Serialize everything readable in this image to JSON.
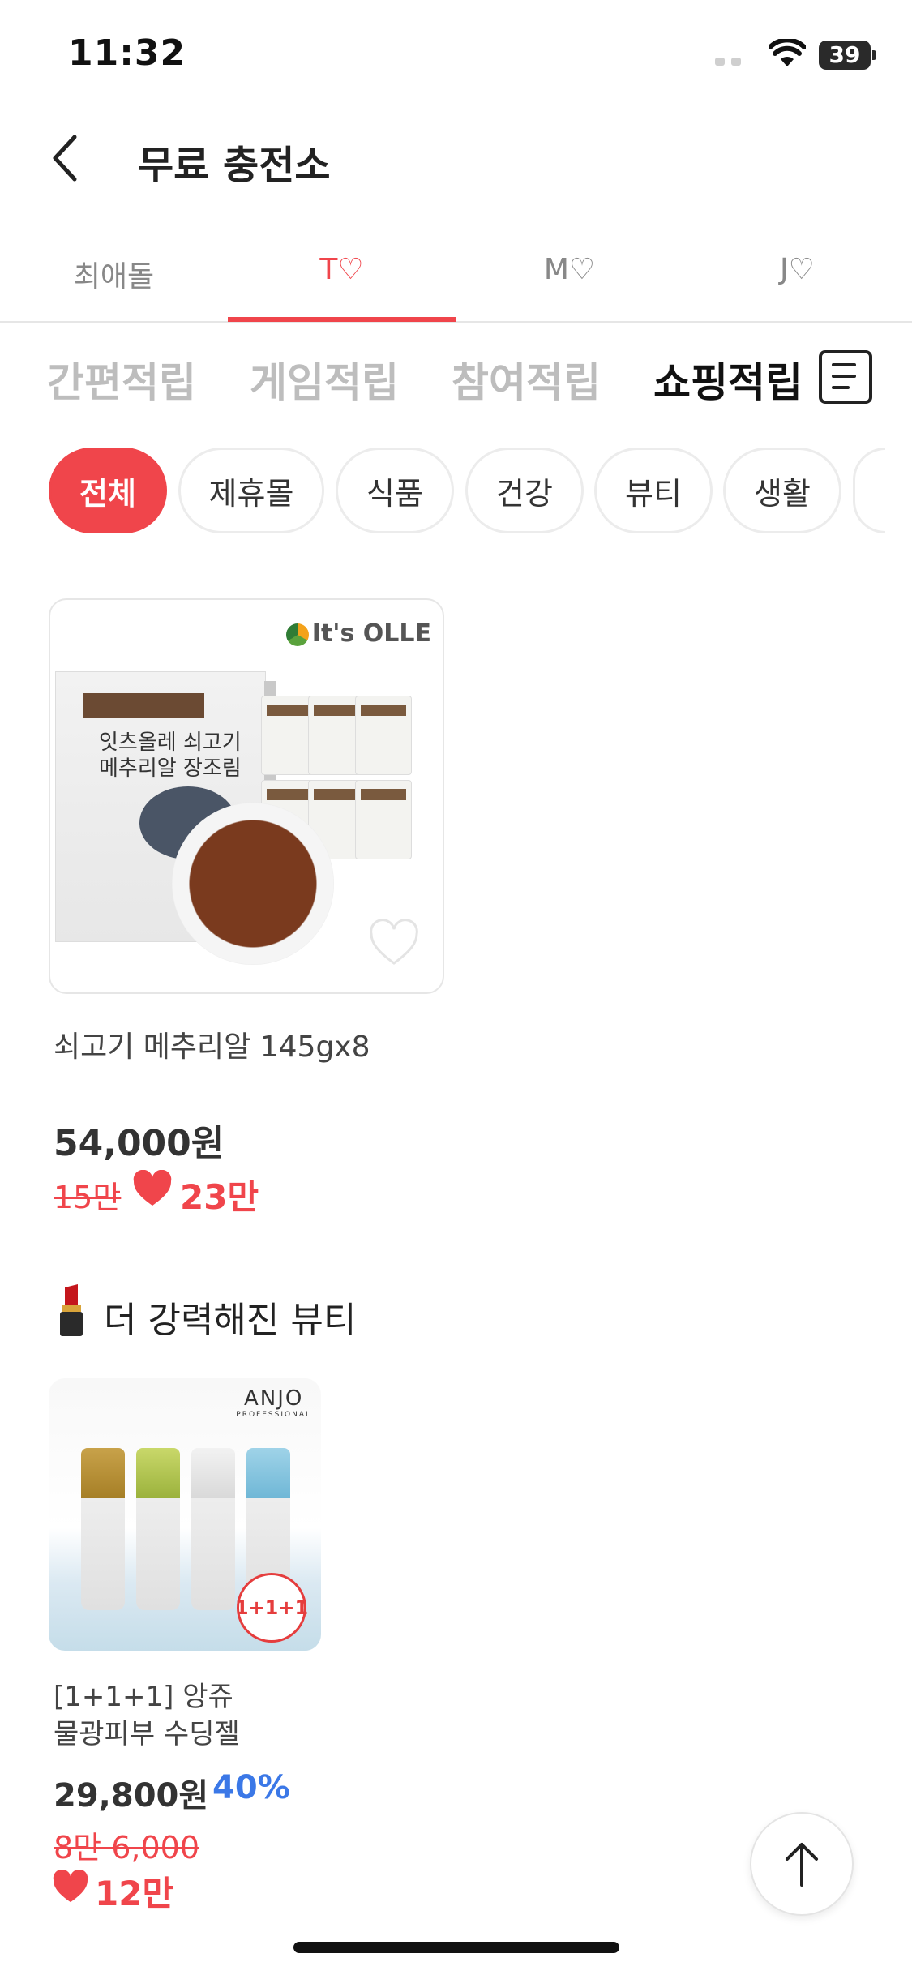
{
  "status": {
    "time": "11:32",
    "battery": "39"
  },
  "header": {
    "title": "무료 충전소",
    "back_icon": "chevron-left-icon"
  },
  "profile_tabs": [
    {
      "label": "최애돌"
    },
    {
      "label": "T♡",
      "active": true
    },
    {
      "label": "M♡"
    },
    {
      "label": "J♡"
    }
  ],
  "category_tabs": [
    {
      "label": "간편적립"
    },
    {
      "label": "게임적립"
    },
    {
      "label": "참여적립"
    },
    {
      "label": "쇼핑적립",
      "active": true
    }
  ],
  "filter_chips": [
    {
      "label": "전체",
      "active": true
    },
    {
      "label": "제휴몰"
    },
    {
      "label": "식품"
    },
    {
      "label": "건강"
    },
    {
      "label": "뷰티"
    },
    {
      "label": "생활"
    }
  ],
  "products": [
    {
      "brand": "It's OLLE",
      "box_title": "잇츠올레 쇠고기 메추리알 장조림",
      "name": "쇠고기 메추리알 145gx8",
      "price": "54,000원",
      "original_points": "15만",
      "points": "23만"
    },
    {
      "brand": "ANJO",
      "brand_sub": "PROFESSIONAL",
      "badge": "1+1+1",
      "name_line1": "[1+1+1] 앙쥬",
      "name_line2": "물광피부 수딩젤",
      "price": "29,800원",
      "discount": "40%",
      "original_points": "8만 6,000",
      "points": "12만"
    }
  ],
  "section": {
    "title": "더 강력해진 뷰티",
    "emoji_icon": "lipstick-icon"
  },
  "colors": {
    "accent": "#f0454b",
    "discount": "#3b78e7"
  }
}
